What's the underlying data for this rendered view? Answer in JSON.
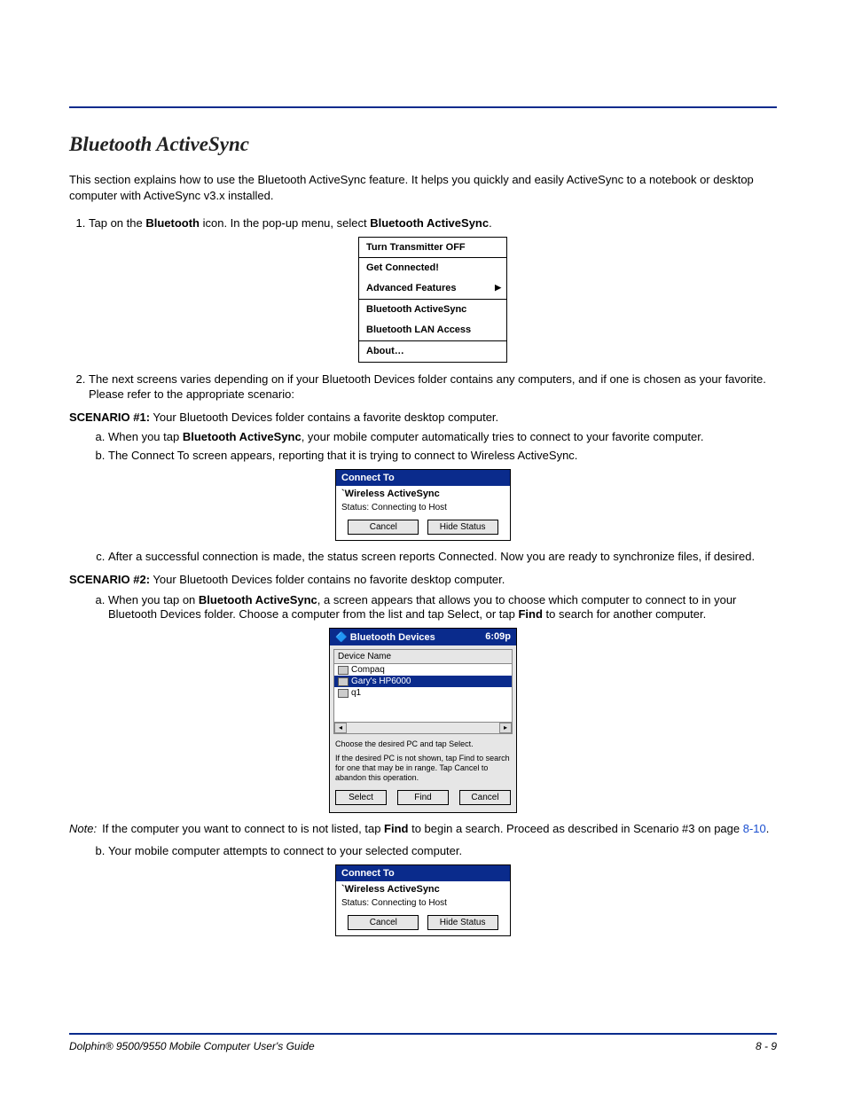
{
  "title": "Bluetooth ActiveSync",
  "intro": "This section explains how to use the Bluetooth ActiveSync feature. It helps you quickly and easily ActiveSync to a notebook or desktop computer with ActiveSync v3.x installed.",
  "step1_a": "Tap on the ",
  "step1_b": "Bluetooth",
  "step1_c": " icon. In the pop-up menu, select ",
  "step1_d": "Bluetooth ActiveSync",
  "step1_e": ".",
  "popup": {
    "item1": "Turn Transmitter OFF",
    "item2": "Get Connected!",
    "item3": "Advanced Features",
    "item4": "Bluetooth ActiveSync",
    "item5": "Bluetooth LAN Access",
    "item6": "About…"
  },
  "step2": "The next screens varies depending on if your Bluetooth Devices folder contains any computers, and if one is chosen as your favorite. Please refer to the appropriate scenario:",
  "scenario1_label": "SCENARIO #1:",
  "scenario1_text": " Your Bluetooth Devices folder contains a favorite desktop computer.",
  "s1a_a": "When you tap ",
  "s1a_b": "Bluetooth ActiveSync",
  "s1a_c": ", your mobile computer automatically tries to connect to your favorite computer.",
  "s1b": "The Connect To screen appears, reporting that it is trying to connect to Wireless ActiveSync.",
  "connect": {
    "title": "Connect To",
    "target": "`Wireless ActiveSync",
    "status_lbl": "Status:  ",
    "status_val": "Connecting to Host",
    "cancel": "Cancel",
    "hide": "Hide Status"
  },
  "s1c": "After a successful connection is made, the status screen reports Connected. Now you are ready to synchronize files, if desired.",
  "scenario2_label": "SCENARIO #2:",
  "scenario2_text": " Your Bluetooth Devices folder contains no favorite desktop computer.",
  "s2a_a": "When you tap on ",
  "s2a_b": "Bluetooth ActiveSync",
  "s2a_c": ", a screen appears that allows you to choose which computer to connect to in your Bluetooth Devices folder. Choose a computer from the list and tap Select, or tap ",
  "s2a_d": "Find",
  "s2a_e": " to search for another computer.",
  "btwin": {
    "title": "Bluetooth Devices",
    "time": "6:09p",
    "header": "Device Name",
    "row1": "Compaq",
    "row2": "Gary's HP6000",
    "row3": "q1",
    "instr1": "Choose the desired PC and tap Select.",
    "instr2": "If the desired PC is not shown, tap Find to search for one that may be in range. Tap Cancel to abandon this operation.",
    "select": "Select",
    "find": "Find",
    "cancel": "Cancel"
  },
  "note_label": "Note:",
  "note_a": "If the computer you want to connect to is not listed, tap ",
  "note_b": "Find",
  "note_c": " to begin a search. Proceed as described in Scenario #3 on page ",
  "note_link": "8-10",
  "note_d": ".",
  "s2b": "Your mobile computer attempts to connect to your selected  computer.",
  "footer_left": "Dolphin® 9500/9550 Mobile Computer User's Guide",
  "footer_right": "8 - 9"
}
